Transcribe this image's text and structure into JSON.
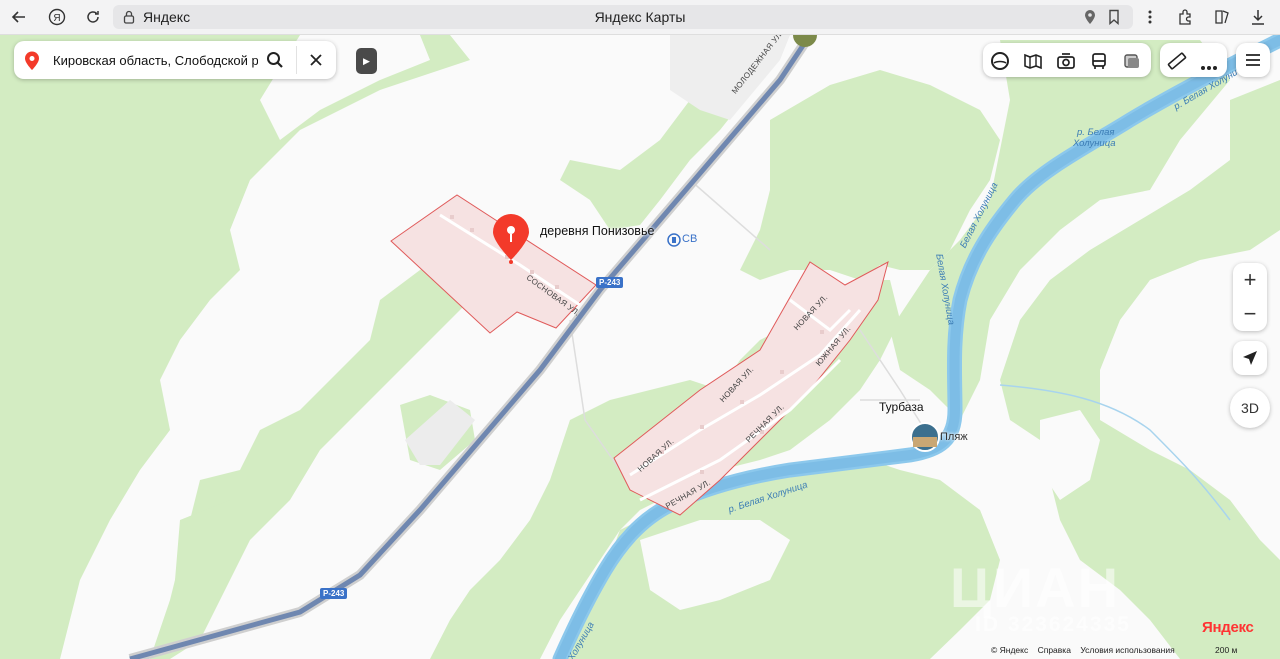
{
  "browser": {
    "address_host": "Яндекс",
    "page_title": "Яндекс Карты"
  },
  "search": {
    "value": "Кировская область, Слободской рай"
  },
  "map": {
    "places": {
      "village": "деревня Понизовье",
      "fuel": "СВ",
      "turbaza": "Турбаза",
      "beach": "Пляж"
    },
    "roads": {
      "badge_1": "Р-243",
      "badge_2": "Р-243",
      "molodezhnaya": "Молодежная ул.",
      "sosnovaya": "Сосновая ул.",
      "novaya_1": "Новая ул.",
      "novaya_2": "Новая ул.",
      "novaya_3": "Новая ул.",
      "rechnaya_1": "Речная ул.",
      "rechnaya_2": "Речная ул.",
      "yuzhnaya": "Южная ул."
    },
    "rivers": {
      "r1_line1": "р. Белая",
      "r1_line2": "Холуница",
      "r2": "р. Белая Холуница",
      "r3": "Белая Холуница",
      "r4": "р. Белая",
      "r5": "Белая Холуница",
      "r6": "р. Белая Холуница",
      "r7": "Холуница"
    },
    "watermark": "ЦИАН",
    "watermark_id": "ID 323624335"
  },
  "controls": {
    "zoom_in": "+",
    "zoom_out": "−",
    "btn_3d": "3D"
  },
  "footer": {
    "copyright": "© Яндекс",
    "help": "Справка",
    "terms": "Условия использования",
    "scale": "200 м",
    "logo": "Яндекс"
  }
}
